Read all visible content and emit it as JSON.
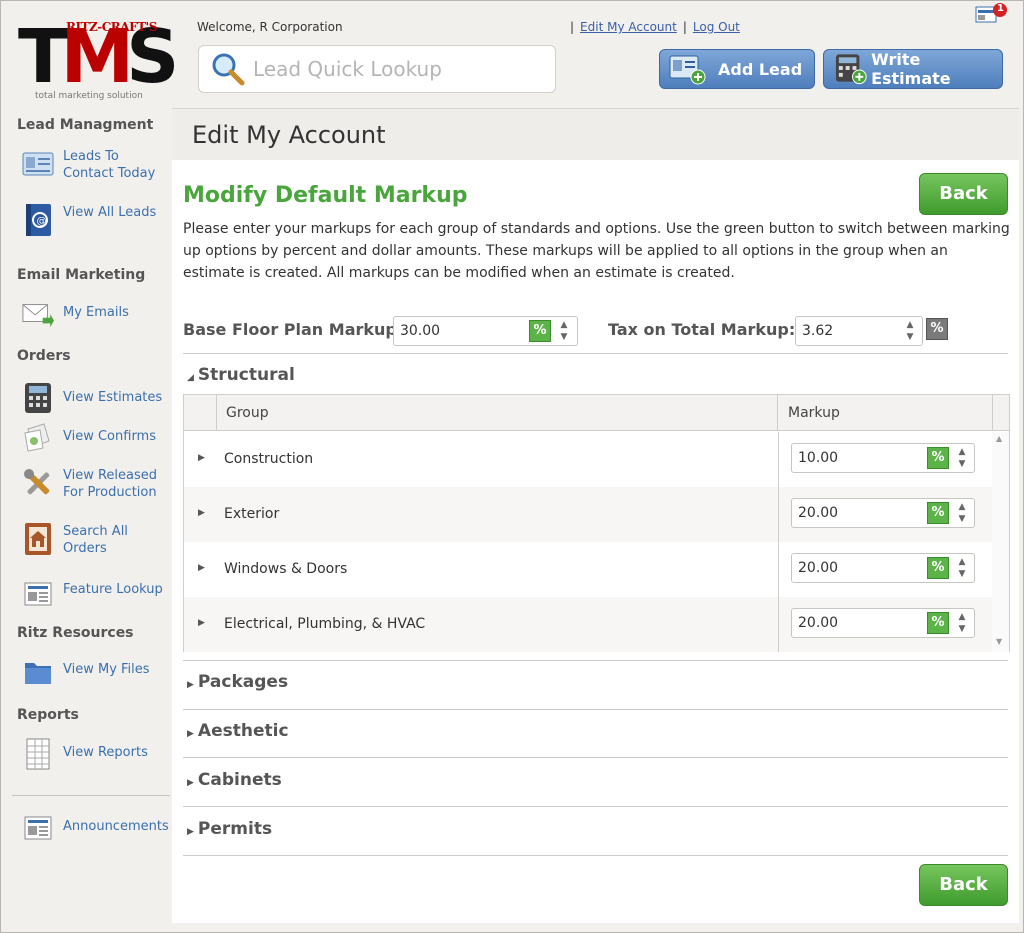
{
  "app": {
    "brand_top": "RITZ-CRAFT'S",
    "brand_main": "TMS",
    "brand_tagline": "total marketing solution",
    "notification_count": "1"
  },
  "header": {
    "welcome": "Welcome, R Corporation",
    "links": [
      "Edit My Account",
      "Log Out"
    ],
    "search_placeholder": "Lead Quick Lookup",
    "add_lead": "Add Lead",
    "write_estimate": "Write Estimate"
  },
  "sidebar": {
    "sections": [
      {
        "title": "Lead Managment",
        "items": [
          "Leads To Contact Today",
          "View All Leads"
        ]
      },
      {
        "title": "Email Marketing",
        "items": [
          "My Emails"
        ]
      },
      {
        "title": "Orders",
        "items": [
          "View Estimates",
          "View Confirms",
          "View Released For Production",
          "Search All Orders",
          "Feature Lookup"
        ]
      },
      {
        "title": "Ritz Resources",
        "items": [
          "View My Files"
        ]
      },
      {
        "title": "Reports",
        "items": [
          "View Reports"
        ]
      }
    ],
    "announcements": "Announcements"
  },
  "page": {
    "title": "Edit My Account",
    "section_title": "Modify Default Markup",
    "back_label": "Back",
    "description": "Please enter your markups for each group of standards and options. Use the green button to switch between marking up options by percent and dollar amounts. These markups will be applied to all options in the group when an estimate is created. All markups can be modified when an estimate is created.",
    "base_label": "Base Floor Plan Markup:",
    "base_value": "30.00",
    "tax_label": "Tax on Total Markup:",
    "tax_value": "3.62",
    "pct_symbol": "%"
  },
  "structural": {
    "title": "Structural",
    "columns": [
      "Group",
      "Markup"
    ],
    "rows": [
      {
        "name": "Construction",
        "markup": "10.00"
      },
      {
        "name": "Exterior",
        "markup": "20.00"
      },
      {
        "name": "Windows & Doors",
        "markup": "20.00"
      },
      {
        "name": "Electrical, Plumbing, & HVAC",
        "markup": "20.00"
      }
    ]
  },
  "other_sections": [
    "Packages",
    "Aesthetic",
    "Cabinets",
    "Permits"
  ],
  "colors": {
    "accent_green": "#4aa63c",
    "link_blue": "#3b6fae",
    "button_blue": "#4e7ebc"
  }
}
